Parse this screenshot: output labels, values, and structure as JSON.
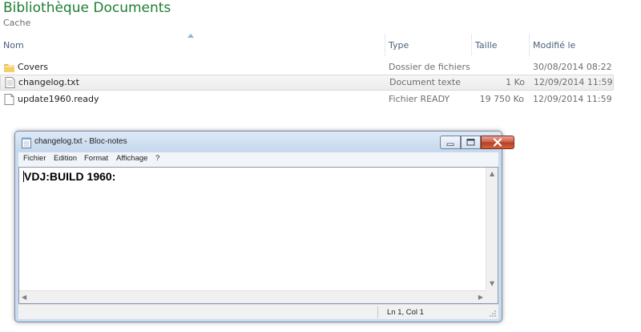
{
  "library": {
    "title": "Bibliothèque Documents",
    "subtitle": "Cache"
  },
  "columns": {
    "name": "Nom",
    "type": "Type",
    "size": "Taille",
    "modified": "Modifié le"
  },
  "files": [
    {
      "name": "Covers",
      "type": "Dossier de fichiers",
      "size": "",
      "modified": "30/08/2014 08:22",
      "icon": "folder-icon"
    },
    {
      "name": "changelog.txt",
      "type": "Document texte",
      "size": "1 Ko",
      "modified": "12/09/2014 11:59",
      "icon": "text-file-icon",
      "selected": true
    },
    {
      "name": "update1960.ready",
      "type": "Fichier READY",
      "size": "19 750 Ko",
      "modified": "12/09/2014 11:59",
      "icon": "file-icon"
    }
  ],
  "notepad": {
    "title": "changelog.txt - Bloc-notes",
    "menu": [
      "Fichier",
      "Edition",
      "Format",
      "Affichage",
      "?"
    ],
    "content": "VDJ:BUILD 1960:",
    "status": "Ln 1, Col 1"
  },
  "colors": {
    "title_green": "#1e7e34",
    "header_text": "#4c607a",
    "selection_bg": "#ececec",
    "close_red": "#c75a45"
  }
}
